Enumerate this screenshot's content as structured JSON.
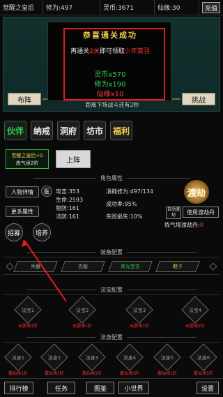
{
  "topbar": {
    "name": "觉醒之皇后",
    "xiuwei": "修为:497",
    "lingbi": "灵币:3671",
    "xianyuan": "仙缘:30",
    "recharge": "充值"
  },
  "scene": {
    "left_button": "布阵",
    "right_button": "挑战",
    "countdown": "距离下场战斗还有2秒"
  },
  "popup": {
    "title": "恭喜通关成功",
    "msg_prefix": "再通关",
    "msg_num": "2关",
    "msg_mid": "即可领取",
    "msg_reward": "少年莫羽",
    "reward1": "灵币x570",
    "reward2": "修为x190",
    "reward3": "仙缘x10"
  },
  "nav": {
    "partner": "伙伴",
    "naj": "纳戒",
    "cave": "洞府",
    "market": "坊市",
    "welfare": "福利"
  },
  "partner_card": {
    "line1": "觉醒之皇后+0",
    "line2": "炼气境2阶"
  },
  "deploy": "上阵",
  "attributes": {
    "title": "角色属性",
    "detail_btn": "人物详情",
    "medicine_btn": "医",
    "more_btn": "更多属性",
    "recruit_btn": "招募",
    "cultivate_btn": "培养",
    "attack": "攻击:353",
    "life": "生命:2593",
    "phys_def": "物防:161",
    "mag_def": "法防:161",
    "consume_xiuwei": "消耗修为:497/134",
    "success_rate": "成功率:95%",
    "fail_loss": "失败损失:10%",
    "dujie": "渡劫",
    "auto": "自动渡劫",
    "use_bottle": "使用渡劫丹",
    "bottle_label": "炼气境渡劫丹:",
    "bottle_count": "0"
  },
  "equip": {
    "title": "装备配置",
    "items": [
      "兵器",
      "衣服",
      "青光宝衣",
      "鞋子"
    ]
  },
  "treasure": {
    "title": "法宝配置",
    "items": [
      {
        "name": "法宝1",
        "state": "元婴境1阶"
      },
      {
        "name": "法宝2",
        "state": "元婴境1阶"
      },
      {
        "name": "法宝3",
        "state": "元婴境1阶"
      },
      {
        "name": "法宝4",
        "state": "元婴境1阶"
      }
    ]
  },
  "body": {
    "title": "法身配置",
    "items": [
      {
        "name": "法身1",
        "state": "散仙境1阶"
      },
      {
        "name": "法身2",
        "state": "散仙境1阶"
      },
      {
        "name": "法身3",
        "state": "散仙境1阶"
      },
      {
        "name": "法身4",
        "state": "散仙境1阶"
      },
      {
        "name": "法身5",
        "state": "散仙境1阶"
      },
      {
        "name": "法身6",
        "state": "散仙境1阶"
      }
    ]
  },
  "bottombar": {
    "rank": "排行榜",
    "task": "任务",
    "atlas": "图鉴",
    "world": "小世界",
    "settings": "设置"
  }
}
